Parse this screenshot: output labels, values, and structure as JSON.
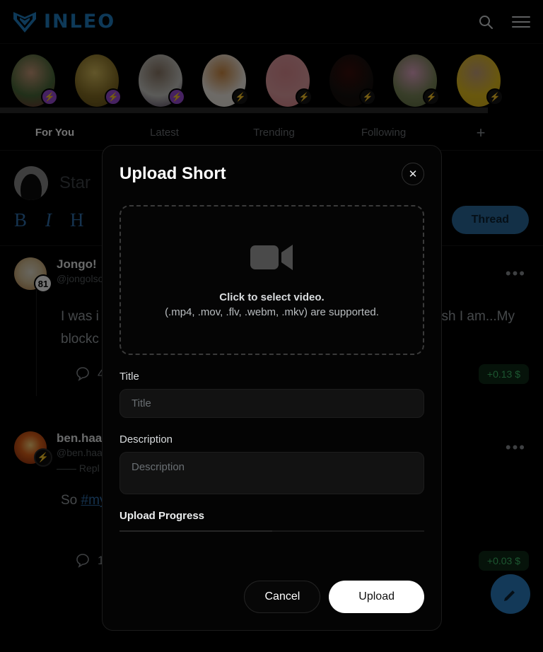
{
  "header": {
    "brand_name": "INLEO",
    "brand_color": "#1f7fc4",
    "search_icon": "search-icon",
    "menu_icon": "hamburger-menu-icon"
  },
  "stories": [
    {
      "label": "story-1",
      "badge": "bolt",
      "badge_style": "purple",
      "colors": [
        "#4a6b3a",
        "#cb9b7a",
        "#7a3030"
      ]
    },
    {
      "label": "story-2",
      "badge": "bolt",
      "badge_style": "purple",
      "colors": [
        "#8a7226",
        "#d9bf5e",
        "#5c4a14"
      ]
    },
    {
      "label": "story-3",
      "badge": "bolt",
      "badge_style": "purple",
      "colors": [
        "#c9c9c4",
        "#8d7a68",
        "#4c3b5a"
      ]
    },
    {
      "label": "story-4",
      "badge": "bolt",
      "badge_style": "dark",
      "colors": [
        "#f2ece4",
        "#d08a42",
        "#e8e2da"
      ]
    },
    {
      "label": "story-5",
      "badge": "bolt",
      "badge_style": "dark",
      "colors": [
        "#e5a0a4",
        "#e08e93",
        "#d97f86"
      ]
    },
    {
      "label": "story-6",
      "badge": "bolt",
      "badge_style": "dark",
      "colors": [
        "#16100e",
        "#3a0f0c",
        "#120b09"
      ]
    },
    {
      "label": "story-7",
      "badge": "bolt",
      "badge_style": "dark",
      "colors": [
        "#7e8a5c",
        "#e5a8c6",
        "#5c6b3e"
      ]
    },
    {
      "label": "story-8",
      "badge": "bolt",
      "badge_style": "dark",
      "colors": [
        "#e8c21e",
        "#caa37c",
        "#d8b018"
      ]
    }
  ],
  "tabs": [
    {
      "label": "For You",
      "active": true
    },
    {
      "label": "Latest",
      "active": false
    },
    {
      "label": "Trending",
      "active": false
    },
    {
      "label": "Following",
      "active": false
    }
  ],
  "tab_add_label": "+",
  "composer": {
    "placeholder": "Star",
    "tools": [
      "B",
      "I",
      "H"
    ],
    "globe_icon": "globe-icon",
    "thread_button": "Thread"
  },
  "posts": [
    {
      "name": "Jongo!",
      "handle": "@jongolso",
      "badge": "81",
      "badge_kind": "number",
      "body_left": "I was i",
      "body_right": "sh I am...My",
      "body_second_line": "blockc",
      "comments": "4",
      "payout": "+0.13 $",
      "menu": "•••"
    },
    {
      "name": "ben.haa",
      "handle": "@ben.haa",
      "badge": "bolt",
      "badge_kind": "bolt",
      "reply_label": "—— Repl",
      "body_left": "So ",
      "body_tag": "#my",
      "comments": "1",
      "payout": "+0.03 $",
      "menu": "•••"
    }
  ],
  "modal": {
    "title": "Upload Short",
    "close_label": "✕",
    "dropzone": {
      "icon": "video-camera-icon",
      "primary_text": "Click to select video.",
      "secondary_text": "(.mp4, .mov, .flv, .webm, .mkv) are supported."
    },
    "title_field": {
      "label": "Title",
      "placeholder": "Title",
      "value": ""
    },
    "description_field": {
      "label": "Description",
      "placeholder": "Description",
      "value": ""
    },
    "progress": {
      "label": "Upload Progress",
      "percent": 50
    },
    "cancel_label": "Cancel",
    "upload_label": "Upload"
  }
}
